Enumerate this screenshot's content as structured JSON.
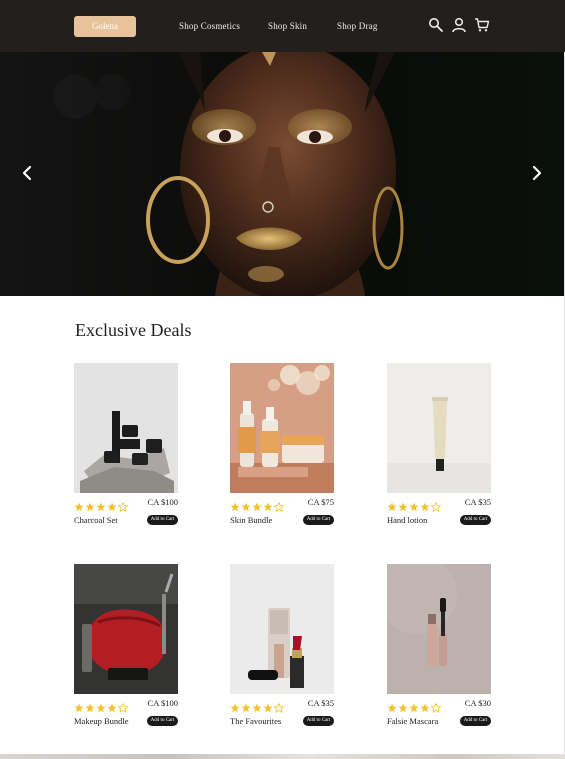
{
  "nav": {
    "logo": "Golena",
    "links": [
      "Shop Cosmetics",
      "Shop Skin",
      "Shop Drag"
    ],
    "icons": [
      "search-icon",
      "user-icon",
      "cart-icon"
    ]
  },
  "hero": {
    "prev_icon": "chevron-left-icon",
    "next_icon": "chevron-right-icon"
  },
  "deals": {
    "title": "Exclusive Deals",
    "products": [
      {
        "name": "Charcoal Set",
        "price": "CA $100",
        "rating": 4,
        "max_rating": 5,
        "button": "Add to Cart"
      },
      {
        "name": "Skin Bundle",
        "price": "CA $75",
        "rating": 4,
        "max_rating": 5,
        "button": "Add to Cart"
      },
      {
        "name": "Hand lotion",
        "price": "CA $35",
        "rating": 4,
        "max_rating": 5,
        "button": "Add to Cart"
      },
      {
        "name": "Makeup Bundle",
        "price": "CA $100",
        "rating": 4,
        "max_rating": 5,
        "button": "Add to Cart"
      },
      {
        "name": "The Favourites",
        "price": "CA $35",
        "rating": 4,
        "max_rating": 5,
        "button": "Add to Cart"
      },
      {
        "name": "Falsie Mascara",
        "price": "CA $30",
        "rating": 4,
        "max_rating": 5,
        "button": "Add to Cart"
      }
    ]
  },
  "colors": {
    "nav_bg": "#231f1d",
    "logo_bg": "#e8c29a",
    "star": "#f2c12e",
    "button_bg": "#1a1a1a"
  }
}
